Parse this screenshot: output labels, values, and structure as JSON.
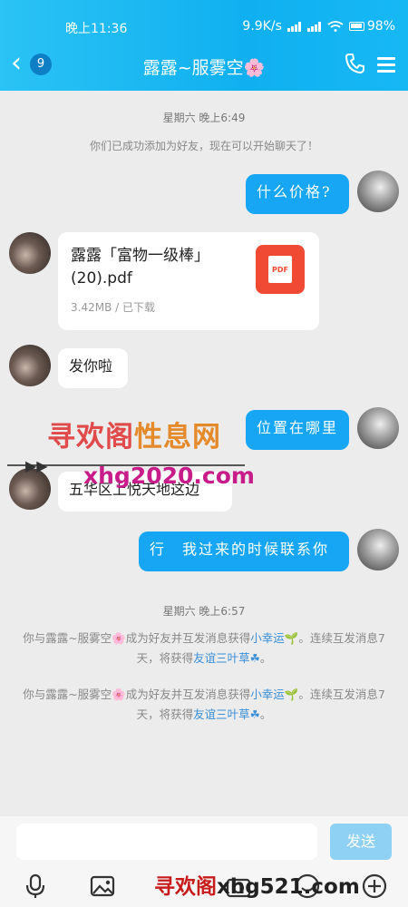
{
  "status_bar": {
    "time": "晚上11:36",
    "net_speed": "9.9K/s",
    "battery": "98%"
  },
  "header": {
    "back_count": "9",
    "chat_name": "露露~服雾空🌸"
  },
  "messages": {
    "time1": "星期六 晚上6:49",
    "system1": "你们已成功添加为好友，现在可以开始聊天了！",
    "me_question": "什么价格?",
    "file": {
      "name": "露露「富物一级棒」(20).pdf",
      "meta": "3.42MB / 已下载",
      "icon_label": "PDF"
    },
    "them_sent": "发你啦",
    "me_location": "位置在哪里",
    "them_location": "五华区上悦天地这边",
    "me_contact": "行　我过来的时候联系你",
    "time2": "星期六 晚上6:57",
    "sys2": {
      "p1": "你与露露~服雾空🌸成为好友并互发消息获得",
      "hl1": "小幸运🌱",
      "p2": "。连续互发消息7天，将获得",
      "hl2": "友谊三叶草☘",
      "p3": "。"
    },
    "sys3": {
      "p1": "你与露露~服雾空🌸成为好友并互发消息获得",
      "hl1": "小幸运🌱",
      "p2": "。连续互发消息7天，将获得",
      "hl2": "友谊三叶草☘",
      "p3": "。"
    }
  },
  "input": {
    "value": "",
    "send_label": "发送"
  },
  "watermarks": {
    "w1a": "寻欢阁",
    "w1b": "性息网",
    "w2": "xhg2020.com",
    "w3a": "寻欢阁",
    "w3b": "xhg521.com"
  },
  "colors": {
    "accent": "#16a6f4",
    "header": "#10b0f0",
    "pdf": "#f04a35"
  },
  "icons": [
    "back-arrow-icon",
    "phone-icon",
    "menu-icon",
    "pdf-icon",
    "microphone-icon",
    "image-icon",
    "camera-icon",
    "emoji-icon",
    "plus-icon"
  ]
}
